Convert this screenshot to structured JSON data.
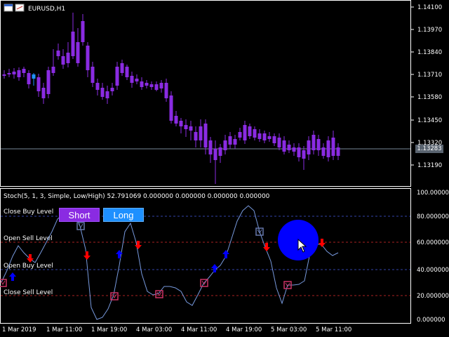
{
  "title_bar": {
    "symbol": "EURUSD,H1"
  },
  "price_axis": {
    "labels": [
      "1.14100",
      "1.13970",
      "1.13840",
      "1.13710",
      "1.13580",
      "1.13450",
      "1.13320",
      "1.13190"
    ],
    "current_price": "1.13283"
  },
  "indicator": {
    "header": "Stoch(5, 1, 3, Simple, Low/High) 52.791069 0.000000 0.000000 0.000000 0.000000",
    "axis_labels": [
      "100.000000",
      "80.000000",
      "60.000000",
      "40.000000",
      "20.000000",
      "0.000000"
    ],
    "levels": {
      "close_buy": "Close Buy Level",
      "open_sell": "Open Sell Level",
      "open_buy": "Open Buy Level",
      "close_sell": "Close Sell Level"
    }
  },
  "buttons": {
    "short_label": "Short",
    "long_label": "Long"
  },
  "time_axis": [
    "1 Mar 2019",
    "1 Mar 11:00",
    "1 Mar 19:00",
    "4 Mar 03:00",
    "4 Mar 11:00",
    "4 Mar 19:00",
    "5 Mar 03:00",
    "5 Mar 11:00"
  ],
  "colors": {
    "bull_candle": "#1e90ff",
    "bear_candle": "#8a2be2",
    "stoch_line": "#7799dd",
    "buy_arrow": "#0000ff",
    "sell_arrow": "#ff0000",
    "close_marker_buy": "#6677aa",
    "close_marker_sell": "#cc3366"
  },
  "icons": [
    "chart-window-icon",
    "mouse-pointer-icon"
  ]
}
